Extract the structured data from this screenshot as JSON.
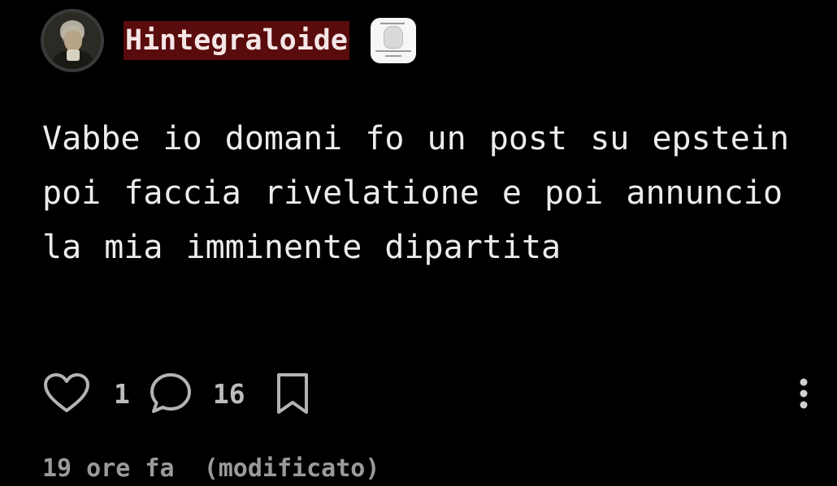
{
  "post": {
    "author": {
      "username": "Hintegraloide",
      "avatar": "avatar",
      "badge": "badge"
    },
    "text": "Vabbe io domani fo un post su epstein poi faccia rivelatione e poi annuncio la mia imminente dipartita",
    "actions": {
      "like_icon": "heart-icon",
      "likes": "1",
      "comment_icon": "comment-icon",
      "comments": "16",
      "save_icon": "bookmark-icon",
      "more_icon": "more-vertical-icon"
    },
    "meta": {
      "time": "19 ore fa",
      "edited": "(modificato)"
    }
  },
  "colors": {
    "background": "#000000",
    "text": "#ececec",
    "username_highlight": "#5a0b0b",
    "muted": "#9a9a9a"
  }
}
